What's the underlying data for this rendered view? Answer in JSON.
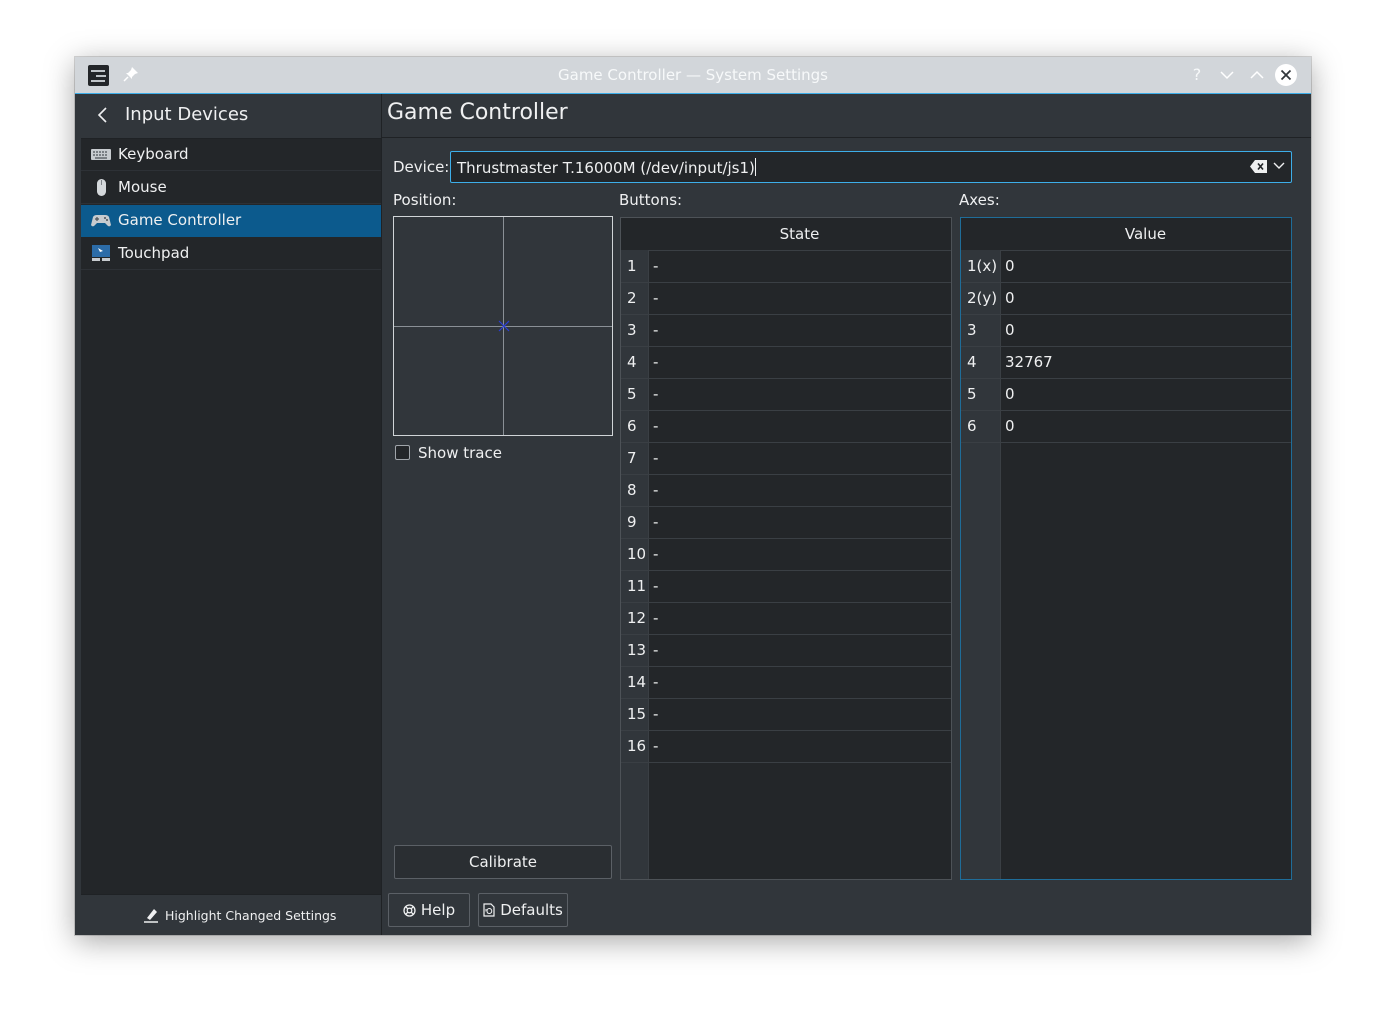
{
  "window": {
    "title": "Game Controller — System Settings",
    "help_glyph": "?"
  },
  "sidebar": {
    "title": "Input Devices",
    "items": [
      {
        "label": "Keyboard",
        "icon": "keyboard-icon",
        "active": false
      },
      {
        "label": "Mouse",
        "icon": "mouse-icon",
        "active": false
      },
      {
        "label": "Game Controller",
        "icon": "gamepad-icon",
        "active": true
      },
      {
        "label": "Touchpad",
        "icon": "touchpad-icon",
        "active": false
      }
    ],
    "footer_label": "Highlight Changed Settings"
  },
  "page": {
    "title": "Game Controller",
    "device_label": "Device:",
    "device_value": "Thrustmaster T.16000M (/dev/input/js1)",
    "position_label": "Position:",
    "buttons_label": "Buttons:",
    "axes_label": "Axes:",
    "show_trace_label": "Show trace",
    "show_trace_checked": false,
    "calibrate_label": "Calibrate",
    "help_label": "Help",
    "defaults_label": "Defaults"
  },
  "buttons_table": {
    "header": "State",
    "rows": [
      {
        "n": "1",
        "v": "-"
      },
      {
        "n": "2",
        "v": "-"
      },
      {
        "n": "3",
        "v": "-"
      },
      {
        "n": "4",
        "v": "-"
      },
      {
        "n": "5",
        "v": "-"
      },
      {
        "n": "6",
        "v": "-"
      },
      {
        "n": "7",
        "v": "-"
      },
      {
        "n": "8",
        "v": "-"
      },
      {
        "n": "9",
        "v": "-"
      },
      {
        "n": "10",
        "v": "-"
      },
      {
        "n": "11",
        "v": "-"
      },
      {
        "n": "12",
        "v": "-"
      },
      {
        "n": "13",
        "v": "-"
      },
      {
        "n": "14",
        "v": "-"
      },
      {
        "n": "15",
        "v": "-"
      },
      {
        "n": "16",
        "v": "-"
      }
    ]
  },
  "axes_table": {
    "header": "Value",
    "rows": [
      {
        "n": "1(x)",
        "v": "0"
      },
      {
        "n": "2(y)",
        "v": "0"
      },
      {
        "n": "3",
        "v": "0"
      },
      {
        "n": "4",
        "v": "32767"
      },
      {
        "n": "5",
        "v": "0"
      },
      {
        "n": "6",
        "v": "0"
      }
    ]
  },
  "colors": {
    "accent": "#3daee9",
    "selection": "#0c5a8d",
    "window_bg": "#31363b",
    "view_bg": "#232629"
  }
}
